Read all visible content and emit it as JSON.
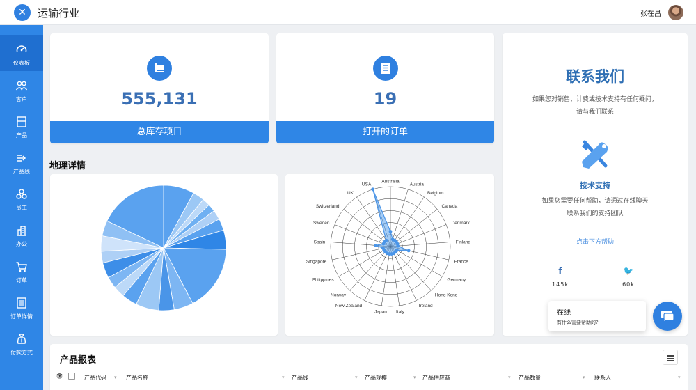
{
  "header": {
    "app_title": "运输行业",
    "logo_glyph": "✕",
    "user_name": "张在昌"
  },
  "sidebar": {
    "items": [
      {
        "label": "仪表板",
        "icon": "dashboard-icon",
        "active": true
      },
      {
        "label": "客户",
        "icon": "users-icon"
      },
      {
        "label": "产品",
        "icon": "box-icon"
      },
      {
        "label": "产品线",
        "icon": "product-line-icon"
      },
      {
        "label": "员工",
        "icon": "employees-icon"
      },
      {
        "label": "办公",
        "icon": "office-icon"
      },
      {
        "label": "订单",
        "icon": "cart-icon"
      },
      {
        "label": "订单详情",
        "icon": "order-details-icon"
      },
      {
        "label": "付款方式",
        "icon": "payment-icon"
      }
    ]
  },
  "stats": [
    {
      "value": "555,131",
      "label": "总库存项目",
      "icon": "inventory-icon"
    },
    {
      "value": "19",
      "label": "打开的订单",
      "icon": "orders-icon"
    }
  ],
  "geo": {
    "title": "地理详情"
  },
  "contact": {
    "title": "联系我们",
    "text1": "如果您对销售、计费或技术支持有任何疑问，",
    "text2": "请与我们联系",
    "support_title": "技术支持",
    "support_text1": "如果您需要任何帮助，请通过在线聊天",
    "support_text2": "联系我们的支持团队",
    "help_link": "点击下方帮助",
    "facebook_glyph": "f",
    "twitter_glyph": "🐦",
    "facebook_count": "145k",
    "twitter_count": "60k"
  },
  "chat": {
    "status": "在线",
    "prompt": "有什么需要帮助的?"
  },
  "report": {
    "title": "产品报表",
    "columns": [
      "产品代码",
      "产品名称",
      "产品线",
      "产品规模",
      "产品供应商",
      "产品数量",
      "联系人"
    ]
  },
  "colors": {
    "primary": "#2f86e6",
    "primary_dark": "#1f6fd0",
    "title_blue": "#3a6fb4"
  },
  "chart_data": [
    {
      "type": "pie",
      "values": [
        8,
        3,
        2,
        2,
        2.5,
        3,
        5,
        17,
        5,
        4,
        6,
        4,
        3,
        3,
        4,
        3,
        4,
        4,
        18
      ],
      "colors": [
        "#5aa2ef",
        "#9cc8f5",
        "#bcd9f8",
        "#6fb0f2",
        "#aed0f6",
        "#5aa2ef",
        "#2f86e6",
        "#5aa2ef",
        "#7db6f3",
        "#4a95e8",
        "#9cc8f5",
        "#5aa2ef",
        "#bcd9f8",
        "#7db6f3",
        "#3d8ee8",
        "#aed0f6",
        "#cfe3fa",
        "#8fc0f4",
        "#5aa2ef"
      ]
    },
    {
      "type": "radar",
      "categories": [
        "Australia",
        "Austria",
        "Belgium",
        "Canada",
        "Denmark",
        "Finland",
        "France",
        "Germany",
        "Hong Kong",
        "Ireland",
        "Italy",
        "Japan",
        "New Zealand",
        "Norway",
        "Philippines",
        "Singapore",
        "Spain",
        "Sweden",
        "Switzerland",
        "UK",
        "USA"
      ],
      "values": [
        2,
        1,
        1,
        1,
        1,
        1,
        2.5,
        1,
        1,
        1,
        1,
        1,
        1,
        1,
        1,
        1,
        2,
        1,
        1,
        1,
        8
      ],
      "rmax": 8,
      "rings": 5
    }
  ]
}
